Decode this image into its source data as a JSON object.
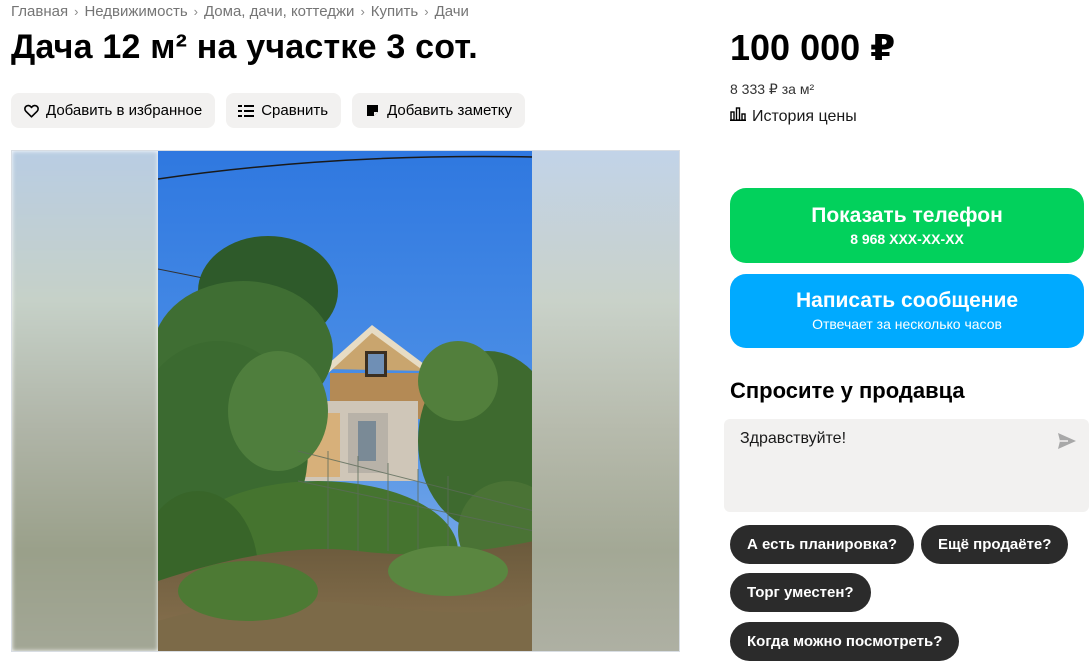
{
  "breadcrumbs": [
    "Главная",
    "Недвижимость",
    "Дома, дачи, коттеджи",
    "Купить",
    "Дачи"
  ],
  "title": "Дача 12 м² на участке 3 сот.",
  "actions": {
    "favorite": "Добавить в избранное",
    "compare": "Сравнить",
    "note": "Добавить заметку"
  },
  "price": {
    "value": "100 000 ₽",
    "per_m": "8 333 ₽ за м²",
    "history": "История цены"
  },
  "contact": {
    "phone_label": "Показать телефон",
    "phone_number": "8 968 XXX-XX-XX",
    "message_label": "Написать сообщение",
    "message_sub": "Отвечает за несколько часов"
  },
  "ask": {
    "title": "Спросите у продавца",
    "input_value": "Здравствуйте!",
    "chips": [
      "А есть планировка?",
      "Ещё продаёте?",
      "Торг уместен?",
      "Когда можно посмотреть?"
    ]
  },
  "colors": {
    "green": "#02d15c",
    "blue": "#00aaff",
    "chip_bg": "#2b2b2b",
    "action_bg": "#f2f1f0"
  },
  "icons": [
    "heart-icon",
    "compare-icon",
    "note-icon",
    "chart-icon",
    "send-icon"
  ]
}
